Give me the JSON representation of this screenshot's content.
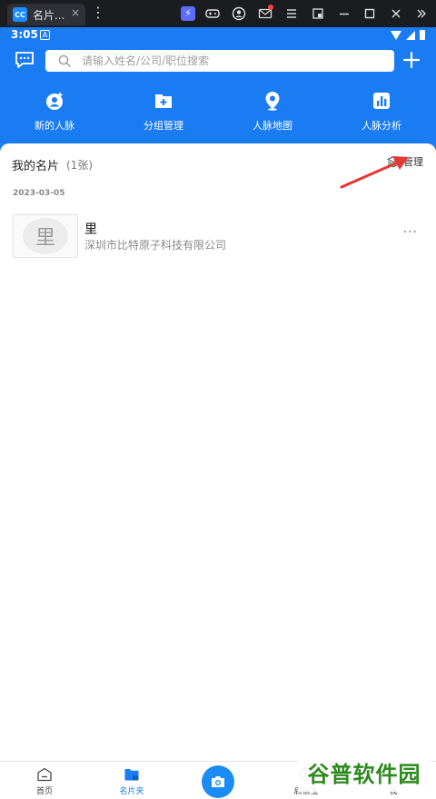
{
  "emulator": {
    "tab_logo": "CC",
    "tab_title": "名片...",
    "close_glyph": "×",
    "more_glyph": "⋮",
    "toolbar_icons": [
      "lightning-icon",
      "gamepad-icon",
      "account-icon",
      "mail-icon",
      "menu-icon",
      "window-icon",
      "minimize-icon",
      "maximize-icon",
      "close-icon",
      "expand-icon"
    ]
  },
  "status_bar": {
    "time": "3:05",
    "app_glyph": "A"
  },
  "header": {
    "search_placeholder": "请输入姓名/公司/职位搜索",
    "quick_nav": [
      {
        "label": "新的人脉",
        "icon": "new-contacts-icon"
      },
      {
        "label": "分组管理",
        "icon": "group-folder-icon"
      },
      {
        "label": "人脉地图",
        "icon": "map-pin-icon"
      },
      {
        "label": "人脉分析",
        "icon": "analytics-icon"
      }
    ]
  },
  "content": {
    "section_title": "我的名片",
    "section_count": "(1张)",
    "manage_label": "管理",
    "date": "2023-03-05",
    "card": {
      "avatar_char": "里",
      "name": "里",
      "company": "深圳市比特原子科技有限公司",
      "more": "···"
    }
  },
  "bottom_nav": {
    "items": [
      {
        "label": "首页",
        "icon": "home-icon"
      },
      {
        "label": "名片夹",
        "icon": "card-folder-icon",
        "active": true
      },
      {
        "label": "",
        "icon": "camera-icon"
      },
      {
        "label": "启信宝",
        "icon": "qixin-icon"
      },
      {
        "label": "我",
        "icon": "profile-icon"
      }
    ]
  },
  "watermark": "谷普软件园",
  "colors": {
    "primary": "#1a7cf2",
    "arrow": "#e53935",
    "watermark": "#2d8a1e"
  }
}
